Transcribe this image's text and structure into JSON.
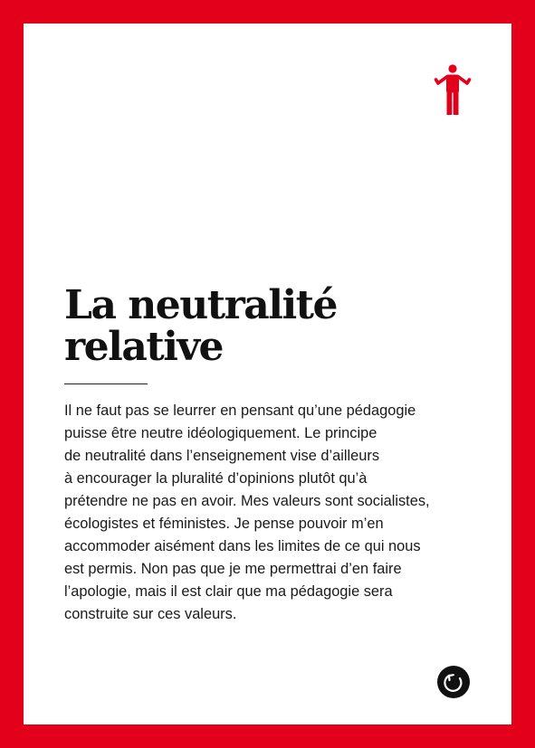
{
  "card": {
    "frame_color": "#e3001b",
    "background_color": "#ffffff",
    "top_icon": "person-shrugging-icon",
    "title_lines": [
      "La neutralité",
      "relative"
    ],
    "body_lines": [
      "Il ne faut pas se leurrer en pensant qu’une pédagogie",
      "puisse être neutre idéologiquement. Le principe",
      "de neutralité dans l’enseignement vise d’ailleurs",
      "à encourager la pluralité d’opinions plutôt qu’à",
      "prétendre ne pas en avoir. Mes valeurs sont socialistes,",
      "écologistes et féministes. Je pense pouvoir m’en",
      "accommoder aisément dans les limites de ce qui nous",
      "est permis. Non pas que je me permettrai d’en faire",
      "l’apologie, mais il est clair que ma pédagogie sera",
      "construite sur ces valeurs."
    ],
    "bottom_icon": "rotate-arrow-icon"
  }
}
